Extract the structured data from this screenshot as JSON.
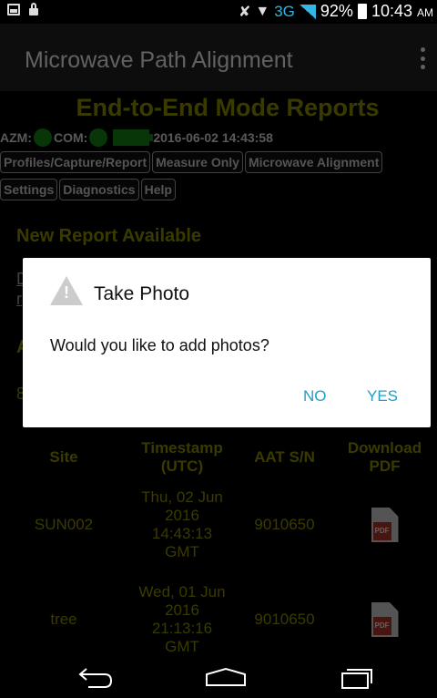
{
  "status_bar": {
    "network": "3G",
    "battery_percent": "92%",
    "time": "10:43",
    "am_pm": "AM"
  },
  "app": {
    "title": "Microwave Path Alignment"
  },
  "page": {
    "heading": "End-to-End Mode Reports",
    "azm_label": "AZM:",
    "com_label": "COM:",
    "datetime": "2016-06-02 14:43:58",
    "nav_row1": [
      "Profiles/Capture/Report",
      "Measure Only",
      "Microwave Alignment"
    ],
    "nav_row2": [
      "Settings",
      "Diagnostics",
      "Help"
    ],
    "new_report_heading": "New Report Available",
    "partial_letters": [
      "D",
      "r",
      "A",
      "8"
    ]
  },
  "table": {
    "headers": {
      "site": "Site",
      "timestamp_line1": "Timestamp",
      "timestamp_line2": "(UTC)",
      "sn": "AAT S/N",
      "download_line1": "Download",
      "download_line2": "PDF"
    },
    "rows": [
      {
        "site": "SUN002",
        "ts1": "Thu, 02 Jun",
        "ts2": "2016",
        "ts3": "14:43:13",
        "ts4": "GMT",
        "sn": "9010650",
        "pdf": "PDF"
      },
      {
        "site": "tree",
        "ts1": "Wed, 01 Jun",
        "ts2": "2016",
        "ts3": "21:13:16",
        "ts4": "GMT",
        "sn": "9010650",
        "pdf": "PDF"
      }
    ]
  },
  "dialog": {
    "title": "Take Photo",
    "message": "Would you like to add photos?",
    "no_label": "NO",
    "yes_label": "YES"
  },
  "colors": {
    "accent": "#1ba1c9",
    "heading_olive": "#999900",
    "status_green": "#1a8f1a"
  }
}
